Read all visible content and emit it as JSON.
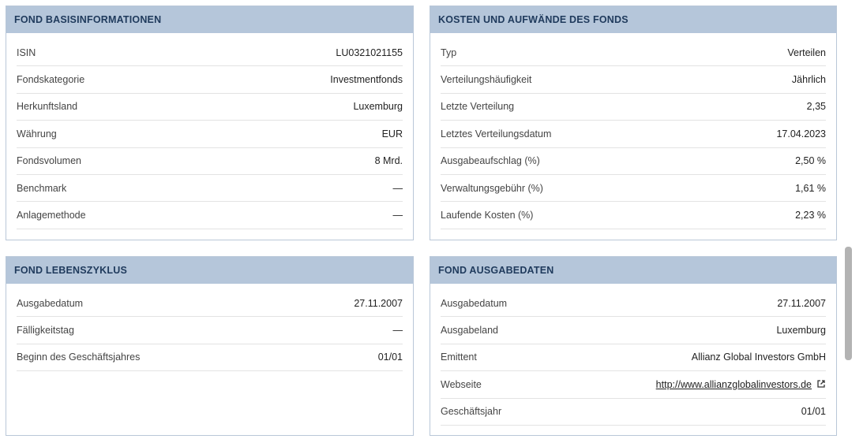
{
  "basis": {
    "title": "FOND BASISINFORMATIONEN",
    "rows": [
      {
        "label": "ISIN",
        "value": "LU0321021155"
      },
      {
        "label": "Fondskategorie",
        "value": "Investmentfonds"
      },
      {
        "label": "Herkunftsland",
        "value": "Luxemburg"
      },
      {
        "label": "Währung",
        "value": "EUR"
      },
      {
        "label": "Fondsvolumen",
        "value": "8 Mrd."
      },
      {
        "label": "Benchmark",
        "value": "—"
      },
      {
        "label": "Anlagemethode",
        "value": "—"
      }
    ]
  },
  "kosten": {
    "title": "KOSTEN UND AUFWÄNDE DES FONDS",
    "rows": [
      {
        "label": "Typ",
        "value": "Verteilen"
      },
      {
        "label": "Verteilungshäufigkeit",
        "value": "Jährlich"
      },
      {
        "label": "Letzte Verteilung",
        "value": "2,35"
      },
      {
        "label": "Letztes Verteilungsdatum",
        "value": "17.04.2023"
      },
      {
        "label": "Ausgabeaufschlag (%)",
        "value": "2,50 %"
      },
      {
        "label": "Verwaltungsgebühr (%)",
        "value": "1,61 %"
      },
      {
        "label": "Laufende Kosten (%)",
        "value": "2,23 %"
      }
    ]
  },
  "lebenszyklus": {
    "title": "FOND LEBENSZYKLUS",
    "rows": [
      {
        "label": "Ausgabedatum",
        "value": "27.11.2007"
      },
      {
        "label": "Fälligkeitstag",
        "value": "—"
      },
      {
        "label": "Beginn des Geschäftsjahres",
        "value": "01/01"
      }
    ]
  },
  "ausgabedaten": {
    "title": "FOND AUSGABEDATEN",
    "rows": [
      {
        "label": "Ausgabedatum",
        "value": "27.11.2007"
      },
      {
        "label": "Ausgabeland",
        "value": "Luxemburg"
      },
      {
        "label": "Emittent",
        "value": "Allianz Global Investors GmbH"
      },
      {
        "label": "Webseite",
        "value": "http://www.allianzglobalinvestors.de"
      },
      {
        "label": "Geschäftsjahr",
        "value": "01/01"
      }
    ]
  },
  "icons": {
    "external_link": "external-link-icon"
  },
  "colors": {
    "header_bg": "#b5c6da",
    "header_text": "#1f3a5c",
    "border": "#b9c7d8"
  }
}
